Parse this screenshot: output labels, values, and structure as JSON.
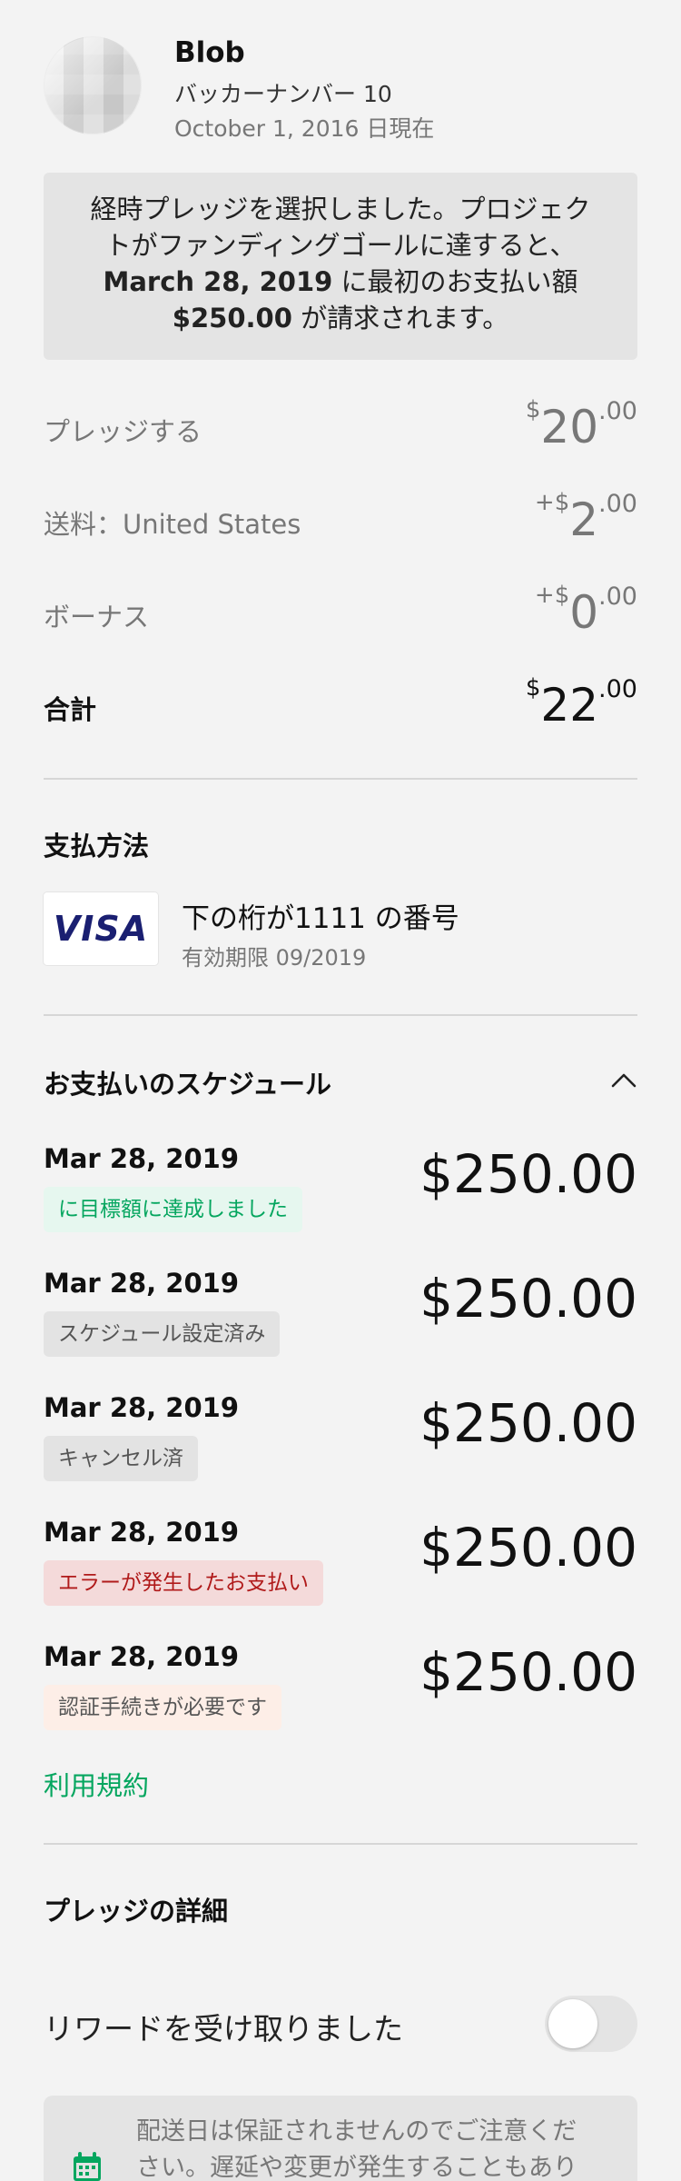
{
  "header": {
    "name": "Blob",
    "backer": "バッカーナンバー 10",
    "as_of": "October 1, 2016 日現在"
  },
  "notice": {
    "line1": "経時プレッジを選択しました。プロジェク",
    "line2": "トがファンディングゴールに達すると、",
    "date": "March 28, 2019",
    "line3": " に最初のお支払い額",
    "amount": "$250.00",
    "line4": " が請求されます。"
  },
  "summary": {
    "pledge": {
      "label": "プレッジする",
      "prefix": "$",
      "whole": "20",
      "cents": ".00"
    },
    "shipping": {
      "label": "送料：United States",
      "prefix": "+$",
      "whole": "2",
      "cents": ".00"
    },
    "bonus": {
      "label": "ボーナス",
      "prefix": "+$",
      "whole": "0",
      "cents": ".00"
    },
    "total": {
      "label": "合計",
      "prefix": "$",
      "whole": "22",
      "cents": ".00"
    }
  },
  "payment": {
    "title": "支払方法",
    "brand": "VISA",
    "card_number": "下の桁が1111 の番号",
    "expiry": "有効期限 09/2019"
  },
  "schedule": {
    "title": "お支払いのスケジュール",
    "items": [
      {
        "date": "Mar 28, 2019",
        "status": "に目標額に達成しました",
        "amount": "$250.00"
      },
      {
        "date": "Mar 28, 2019",
        "status": "スケジュール設定済み",
        "amount": "$250.00"
      },
      {
        "date": "Mar 28, 2019",
        "status": "キャンセル済",
        "amount": "$250.00"
      },
      {
        "date": "Mar 28, 2019",
        "status": "エラーが発生したお支払い",
        "amount": "$250.00"
      },
      {
        "date": "Mar 28, 2019",
        "status": "認証手続きが必要です",
        "amount": "$250.00"
      }
    ]
  },
  "terms_link": "利用規約",
  "pledge_details": {
    "title": "プレッジの詳細",
    "reward_label": "リワードを受け取りました",
    "reward_received": false,
    "shipping_notice": "配送日は保証されませんのでご注意ください。遅延や変更が発生することもありま"
  },
  "colors": {
    "accent_green": "#05a65f",
    "error_red": "#b01a1a",
    "visa_blue": "#1a1f71"
  }
}
